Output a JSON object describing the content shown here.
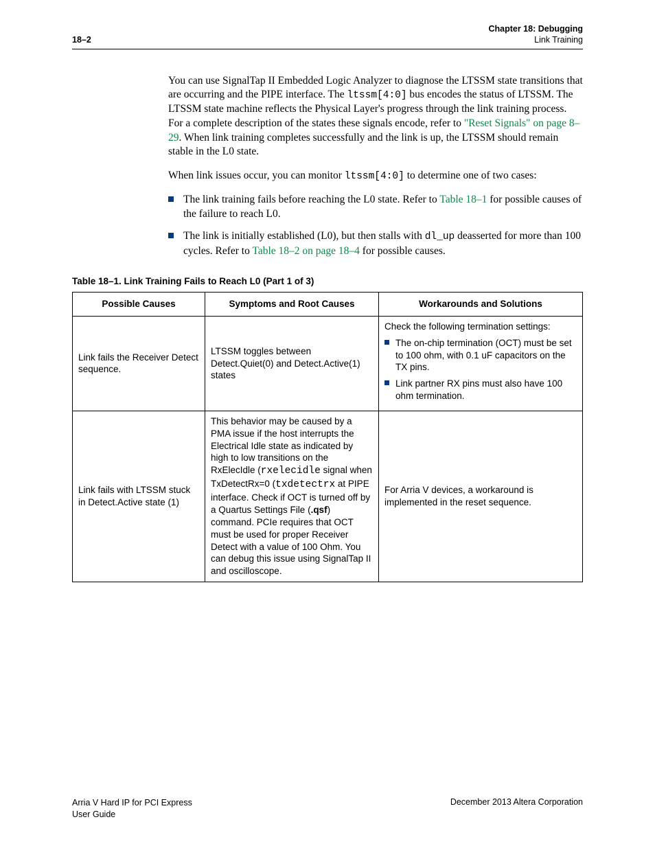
{
  "header": {
    "page_num": "18–2",
    "chapter": "Chapter 18:  Debugging",
    "section": "Link Training"
  },
  "para1": {
    "t1": "You can use SignalTap II Embedded Logic Analyzer to diagnose the LTSSM state transitions that are occurring and the PIPE interface. The ",
    "code1": "ltssm[4:0]",
    "t2": " bus encodes the status of LTSSM. The LTSSM state machine reflects the Physical Layer's progress through the link training process. For a complete description of the states these signals encode, refer to ",
    "link1": "\"Reset Signals\" on page 8–29",
    "t3": ". When link training completes successfully and the link is up, the LTSSM should remain stable in the L0 state."
  },
  "para2": {
    "t1": "When link issues occur, you can monitor ",
    "code1": "ltssm[4:0]",
    "t2": " to determine one of two cases:"
  },
  "bullets": {
    "b1_t1": "The link training fails before reaching the L0 state. Refer to ",
    "b1_link": "Table 18–1",
    "b1_t2": " for possible causes of the failure to reach L0.",
    "b2_t1": "The link is initially established (L0), but then stalls with ",
    "b2_code": "dl_up",
    "b2_t2": " deasserted for more than 100 cycles. Refer to ",
    "b2_link": "Table 18–2 on page 18–4",
    "b2_t3": " for possible causes."
  },
  "table": {
    "caption": "Table 18–1.  Link Training Fails to Reach L0  (Part 1 of 3)",
    "headers": {
      "c1": "Possible Causes",
      "c2": "Symptoms and Root Causes",
      "c3": "Workarounds and Solutions"
    },
    "rows": [
      {
        "c1": "Link fails the Receiver Detect sequence.",
        "c2": "LTSSM toggles between Detect.Quiet(0) and Detect.Active(1) states",
        "c3_lead": "Check the following termination settings:",
        "c3_bullets": [
          "The on-chip termination (OCT) must be set to 100 ohm, with 0.1 uF capacitors on the TX pins.",
          "Link partner RX pins must also have 100 ohm termination."
        ]
      },
      {
        "c1": "Link fails with LTSSM stuck in Detect.Active state (1)",
        "c2_parts": {
          "t1": "This behavior may be caused by a PMA issue if the host interrupts the Electrical Idle state as indicated by high to low transitions on the RxElecIdle (",
          "code1": "rxelecidle",
          "t2": " signal when TxDetectRx=0 (",
          "code2": "txdetectrx",
          "t3": " at PIPE interface. Check if OCT is turned off by a Quartus Settings File (",
          "bold1": ".qsf",
          "t4": ") command. PCIe requires that OCT must be used for proper Receiver Detect with a value of 100 Ohm. You can debug this issue using SignalTap II and oscilloscope."
        },
        "c3": "For Arria  V devices, a workaround is implemented in the reset sequence."
      }
    ]
  },
  "footer": {
    "left1": "Arria V Hard IP for PCI Express",
    "left2": "User Guide",
    "right": "December 2013   Altera Corporation"
  }
}
